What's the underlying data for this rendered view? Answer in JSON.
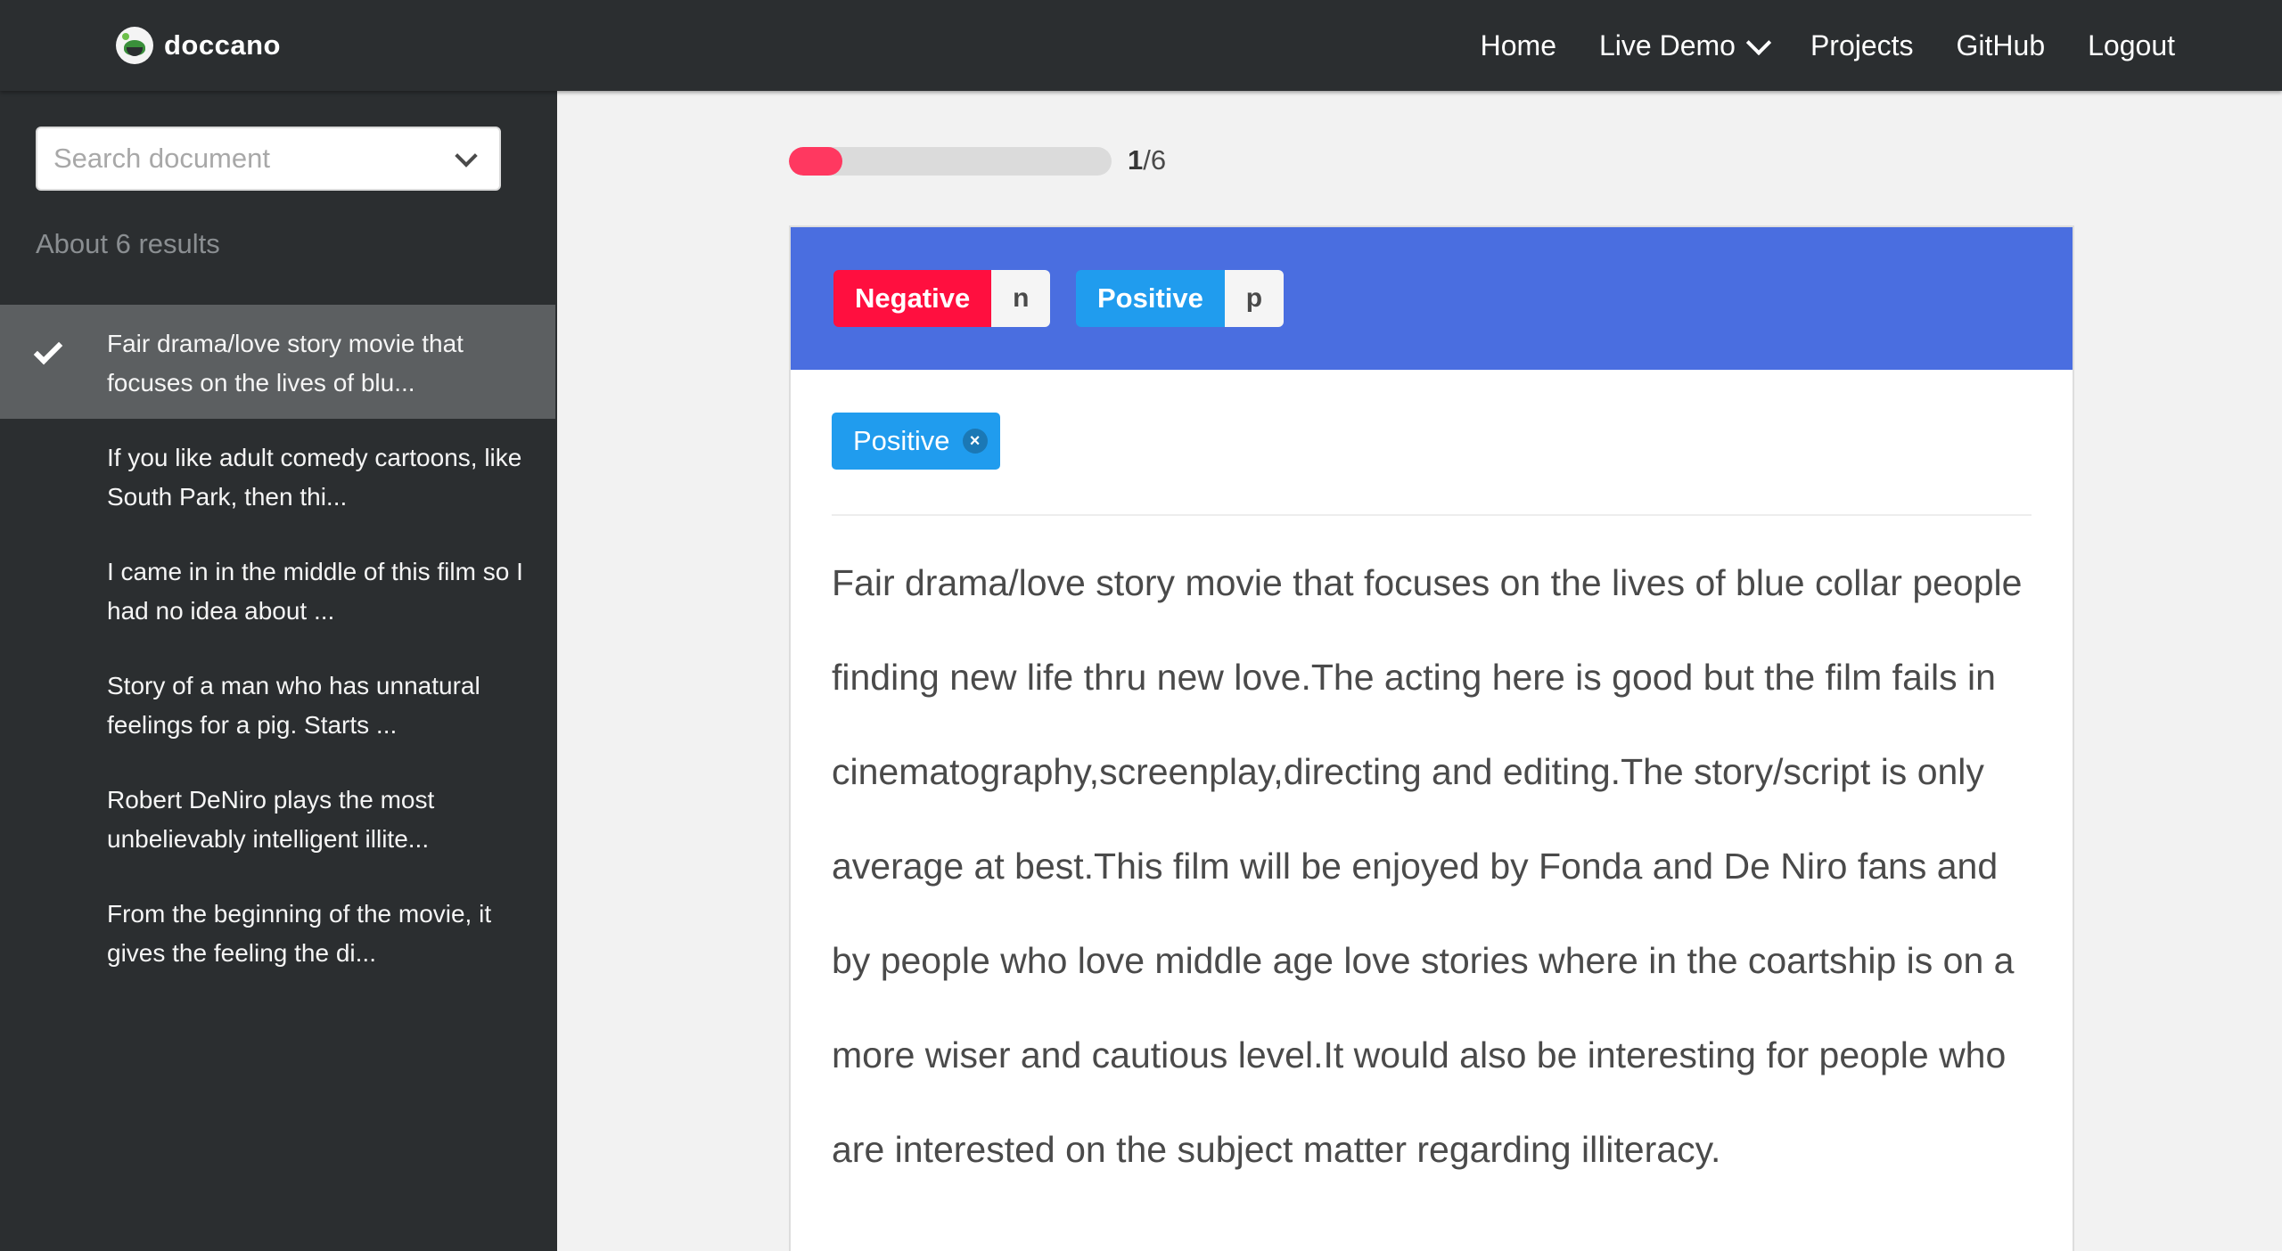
{
  "navbar": {
    "brand": "doccano",
    "links": [
      {
        "label": "Home"
      },
      {
        "label": "Live Demo"
      },
      {
        "label": "Projects"
      },
      {
        "label": "GitHub"
      },
      {
        "label": "Logout"
      }
    ]
  },
  "sidebar": {
    "search_placeholder": "Search document",
    "results_count": "About 6 results",
    "documents": [
      {
        "text": "Fair drama/love story movie that focuses on the lives of blu...",
        "active": true
      },
      {
        "text": "If you like adult comedy cartoons, like South Park, then thi..."
      },
      {
        "text": "I came in in the middle of this film so I had no idea about ..."
      },
      {
        "text": "Story of a man who has unnatural feelings for a pig. Starts ..."
      },
      {
        "text": "Robert DeNiro plays the most unbelievably intelligent illite..."
      },
      {
        "text": "From the beginning of the movie, it gives the feeling the di..."
      }
    ]
  },
  "progress": {
    "current": "1",
    "total": "/6",
    "fraction": 0.1667,
    "color": "#ff3860"
  },
  "labels": [
    {
      "name": "Negative",
      "shortcut": "n",
      "color": "#ff0f3f"
    },
    {
      "name": "Positive",
      "shortcut": "p",
      "color": "#209cee"
    }
  ],
  "annotations": [
    {
      "label": "Positive",
      "color": "#209cee"
    }
  ],
  "document": {
    "text": "Fair drama/love story movie that focuses on the lives of blue collar people finding new life thru new love.The acting here is good but the film fails in cinematography,screenplay,directing and editing.The story/script is only average at best.This film will be enjoyed by Fonda and De Niro fans and by people who love middle age love stories where in the coartship is on a more wiser and cautious level.It would also be interesting for people who are interested on the subject matter regarding illiteracy."
  },
  "colors": {
    "navbar": "#2b2e30",
    "header": "#4a6ee0"
  }
}
